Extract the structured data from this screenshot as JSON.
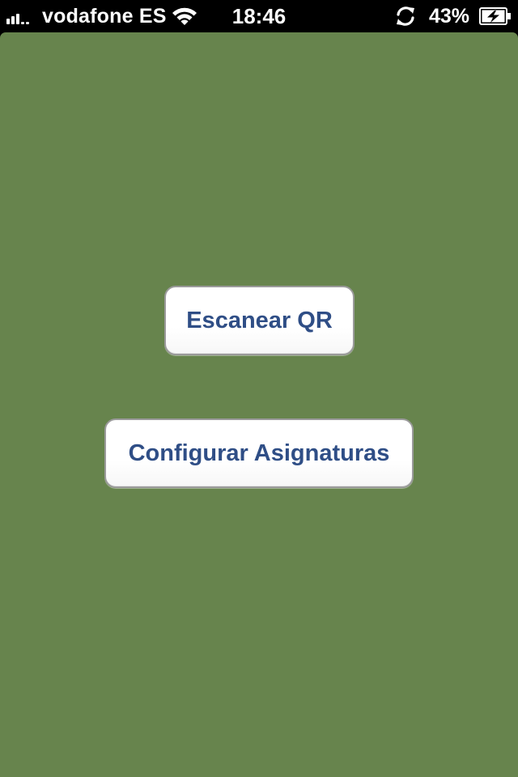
{
  "status_bar": {
    "carrier": "vodafone ES",
    "time": "18:46",
    "battery_percent": "43%",
    "signal_bars_filled": 3,
    "signal_bars_total": 5,
    "icons": [
      "signal-icon",
      "wifi-icon",
      "sync-icon",
      "battery-charging-icon"
    ]
  },
  "main": {
    "background_color": "#67844d",
    "scan_button_label": "Escanear QR",
    "config_button_label": "Configurar Asignaturas",
    "button_text_color": "#2f4e86"
  }
}
